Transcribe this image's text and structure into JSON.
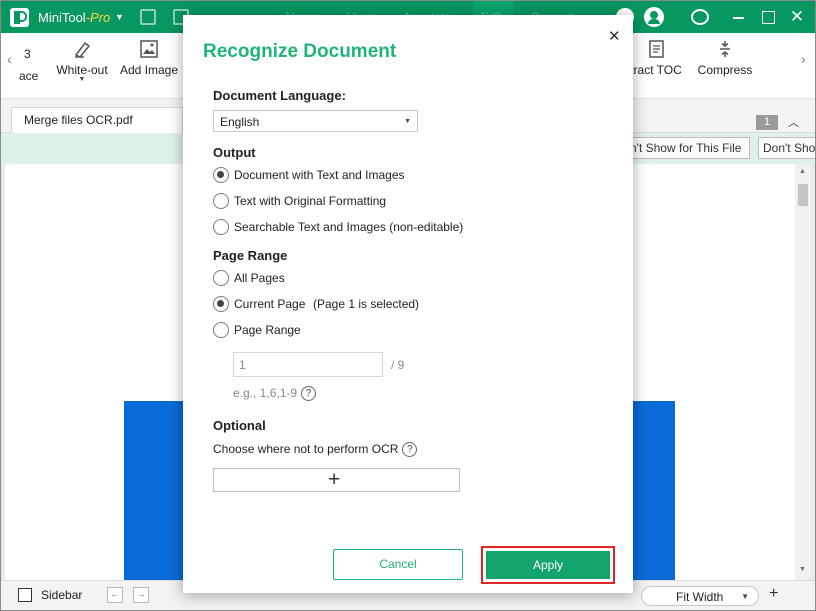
{
  "titlebar": {
    "app_name": "MiniTool",
    "app_edition": "-Pro",
    "faint_tabs": [
      "Home",
      "View",
      "Annotate",
      "Edit",
      "Convert"
    ]
  },
  "ribbon": {
    "tools": [
      {
        "label": "ace",
        "prefix": "3"
      },
      {
        "label": "White-out",
        "icon": "eraser-icon"
      },
      {
        "label": "Add Image",
        "icon": "image-icon"
      },
      {
        "label": "tract TOC",
        "icon": "toc-icon"
      },
      {
        "label": "Compress",
        "icon": "compress-icon"
      }
    ]
  },
  "doc_tab": {
    "name": "Merge files OCR.pdf"
  },
  "page_badge": "1",
  "noticebar": {
    "buttons": [
      "n't Show for This File",
      "Don't Sho"
    ]
  },
  "statusbar": {
    "sidebar_label": "Sidebar",
    "zoom_mode": "Fit Width"
  },
  "dialog": {
    "title": "Recognize Document",
    "language_label": "Document Language:",
    "language_value": "English",
    "output_label": "Output",
    "output_options": [
      {
        "label": "Document with Text and Images",
        "selected": true
      },
      {
        "label": "Text with Original Formatting",
        "selected": false
      },
      {
        "label": "Searchable Text and Images (non-editable)",
        "selected": false
      }
    ],
    "page_range_label": "Page Range",
    "page_options": [
      {
        "label": "All Pages",
        "selected": false
      },
      {
        "label": "Current Page",
        "selected": true,
        "note": "(Page 1 is selected)"
      },
      {
        "label": "Page Range",
        "selected": false
      }
    ],
    "range_value": "1",
    "range_total": "/ 9",
    "range_example": "e.g., 1,6,1-9",
    "optional_label": "Optional",
    "ocr_exclude_label": "Choose where not to perform OCR",
    "cancel_label": "Cancel",
    "apply_label": "Apply"
  },
  "colors": {
    "brand_green": "#07985f",
    "accent_green": "#20b477",
    "apply_green": "#14a56c",
    "highlight_red": "#e02424",
    "page_blue": "#0a6bd8"
  }
}
